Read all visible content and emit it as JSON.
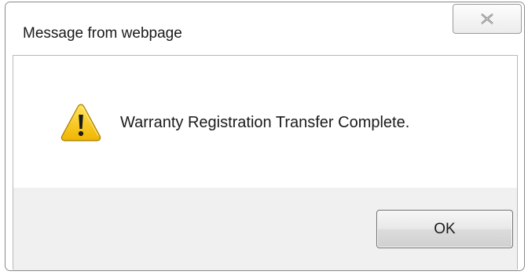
{
  "dialog": {
    "title": "Message from webpage",
    "message": "Warranty Registration Transfer Complete.",
    "icon": "warning-icon",
    "ok_label": "OK",
    "close_icon": "close-icon"
  },
  "colors": {
    "footer_background": "#f0f0f0",
    "border": "#8a8a8a",
    "warning_yellow": "#f5c400"
  }
}
